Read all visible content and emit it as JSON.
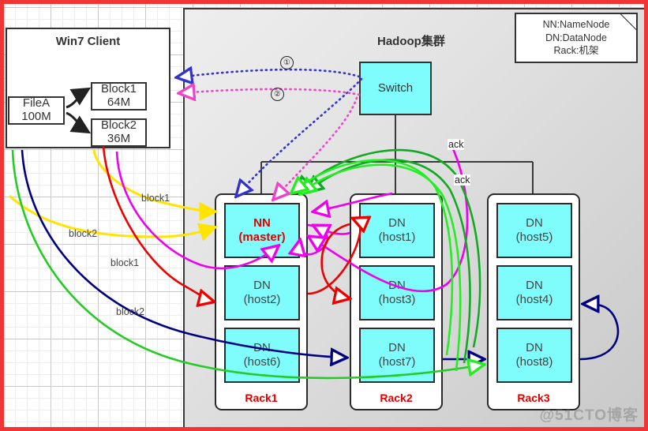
{
  "frame": {
    "border_color": "#f33434"
  },
  "client": {
    "title": "Win7 Client",
    "file": {
      "name": "FileA",
      "size": "100M"
    },
    "blocks": [
      {
        "name": "Block1",
        "size": "64M"
      },
      {
        "name": "Block2",
        "size": "36M"
      }
    ]
  },
  "cluster": {
    "title": "Hadoop集群",
    "switch_label": "Switch",
    "legend": {
      "lines": [
        "NN:NameNode",
        "DN:DataNode",
        "Rack:机架"
      ]
    },
    "racks": [
      {
        "name": "Rack1",
        "nodes": [
          {
            "line1": "NN",
            "line2": "(master)",
            "role": "nn"
          },
          {
            "line1": "DN",
            "line2": "(host2)",
            "role": "dn"
          },
          {
            "line1": "DN",
            "line2": "(host6)",
            "role": "dn"
          }
        ]
      },
      {
        "name": "Rack2",
        "nodes": [
          {
            "line1": "DN",
            "line2": "(host1)",
            "role": "dn"
          },
          {
            "line1": "DN",
            "line2": "(host3)",
            "role": "dn"
          },
          {
            "line1": "DN",
            "line2": "(host7)",
            "role": "dn"
          }
        ]
      },
      {
        "name": "Rack3",
        "nodes": [
          {
            "line1": "DN",
            "line2": "(host5)",
            "role": "dn"
          },
          {
            "line1": "DN",
            "line2": "(host4)",
            "role": "dn"
          },
          {
            "line1": "DN",
            "line2": "(host8)",
            "role": "dn"
          }
        ]
      }
    ]
  },
  "annotations": {
    "step1": "①",
    "step2": "②",
    "ack1": "ack",
    "ack2": "ack",
    "edge_labels": [
      {
        "text": "block1",
        "color": "#ffe400"
      },
      {
        "text": "block2",
        "color": "#ffe400"
      },
      {
        "text": "block1",
        "color": "#ee0000"
      },
      {
        "text": "block2",
        "color": "#000080"
      }
    ]
  },
  "watermark": "@51CTO博客",
  "colors": {
    "node_fill": "#7ffcfc",
    "rack_label": "#e00000",
    "panel_bg": "#d9d9d9",
    "dotted_blue": "#3333cc",
    "dotted_magenta": "#ee44cc",
    "yellow": "#ffe400",
    "magenta": "#ee00ee",
    "red": "#ee0000",
    "navy": "#000080",
    "green_dark": "#11aa22",
    "green_bright": "#22ee22"
  }
}
